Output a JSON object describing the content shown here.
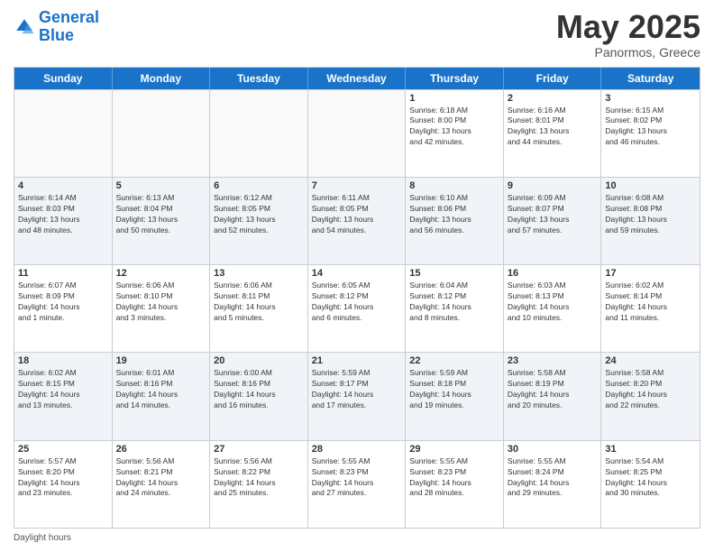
{
  "logo": {
    "line1": "General",
    "line2": "Blue"
  },
  "title": "May 2025",
  "subtitle": "Panormos, Greece",
  "days_of_week": [
    "Sunday",
    "Monday",
    "Tuesday",
    "Wednesday",
    "Thursday",
    "Friday",
    "Saturday"
  ],
  "footer": "Daylight hours",
  "weeks": [
    [
      {
        "day": "",
        "empty": true
      },
      {
        "day": "",
        "empty": true
      },
      {
        "day": "",
        "empty": true
      },
      {
        "day": "",
        "empty": true
      },
      {
        "day": "1",
        "info": "Sunrise: 6:18 AM\nSunset: 8:00 PM\nDaylight: 13 hours\nand 42 minutes."
      },
      {
        "day": "2",
        "info": "Sunrise: 6:16 AM\nSunset: 8:01 PM\nDaylight: 13 hours\nand 44 minutes."
      },
      {
        "day": "3",
        "info": "Sunrise: 6:15 AM\nSunset: 8:02 PM\nDaylight: 13 hours\nand 46 minutes."
      }
    ],
    [
      {
        "day": "4",
        "info": "Sunrise: 6:14 AM\nSunset: 8:03 PM\nDaylight: 13 hours\nand 48 minutes."
      },
      {
        "day": "5",
        "info": "Sunrise: 6:13 AM\nSunset: 8:04 PM\nDaylight: 13 hours\nand 50 minutes."
      },
      {
        "day": "6",
        "info": "Sunrise: 6:12 AM\nSunset: 8:05 PM\nDaylight: 13 hours\nand 52 minutes."
      },
      {
        "day": "7",
        "info": "Sunrise: 6:11 AM\nSunset: 8:05 PM\nDaylight: 13 hours\nand 54 minutes."
      },
      {
        "day": "8",
        "info": "Sunrise: 6:10 AM\nSunset: 8:06 PM\nDaylight: 13 hours\nand 56 minutes."
      },
      {
        "day": "9",
        "info": "Sunrise: 6:09 AM\nSunset: 8:07 PM\nDaylight: 13 hours\nand 57 minutes."
      },
      {
        "day": "10",
        "info": "Sunrise: 6:08 AM\nSunset: 8:08 PM\nDaylight: 13 hours\nand 59 minutes."
      }
    ],
    [
      {
        "day": "11",
        "info": "Sunrise: 6:07 AM\nSunset: 8:09 PM\nDaylight: 14 hours\nand 1 minute."
      },
      {
        "day": "12",
        "info": "Sunrise: 6:06 AM\nSunset: 8:10 PM\nDaylight: 14 hours\nand 3 minutes."
      },
      {
        "day": "13",
        "info": "Sunrise: 6:06 AM\nSunset: 8:11 PM\nDaylight: 14 hours\nand 5 minutes."
      },
      {
        "day": "14",
        "info": "Sunrise: 6:05 AM\nSunset: 8:12 PM\nDaylight: 14 hours\nand 6 minutes."
      },
      {
        "day": "15",
        "info": "Sunrise: 6:04 AM\nSunset: 8:12 PM\nDaylight: 14 hours\nand 8 minutes."
      },
      {
        "day": "16",
        "info": "Sunrise: 6:03 AM\nSunset: 8:13 PM\nDaylight: 14 hours\nand 10 minutes."
      },
      {
        "day": "17",
        "info": "Sunrise: 6:02 AM\nSunset: 8:14 PM\nDaylight: 14 hours\nand 11 minutes."
      }
    ],
    [
      {
        "day": "18",
        "info": "Sunrise: 6:02 AM\nSunset: 8:15 PM\nDaylight: 14 hours\nand 13 minutes."
      },
      {
        "day": "19",
        "info": "Sunrise: 6:01 AM\nSunset: 8:16 PM\nDaylight: 14 hours\nand 14 minutes."
      },
      {
        "day": "20",
        "info": "Sunrise: 6:00 AM\nSunset: 8:16 PM\nDaylight: 14 hours\nand 16 minutes."
      },
      {
        "day": "21",
        "info": "Sunrise: 5:59 AM\nSunset: 8:17 PM\nDaylight: 14 hours\nand 17 minutes."
      },
      {
        "day": "22",
        "info": "Sunrise: 5:59 AM\nSunset: 8:18 PM\nDaylight: 14 hours\nand 19 minutes."
      },
      {
        "day": "23",
        "info": "Sunrise: 5:58 AM\nSunset: 8:19 PM\nDaylight: 14 hours\nand 20 minutes."
      },
      {
        "day": "24",
        "info": "Sunrise: 5:58 AM\nSunset: 8:20 PM\nDaylight: 14 hours\nand 22 minutes."
      }
    ],
    [
      {
        "day": "25",
        "info": "Sunrise: 5:57 AM\nSunset: 8:20 PM\nDaylight: 14 hours\nand 23 minutes."
      },
      {
        "day": "26",
        "info": "Sunrise: 5:56 AM\nSunset: 8:21 PM\nDaylight: 14 hours\nand 24 minutes."
      },
      {
        "day": "27",
        "info": "Sunrise: 5:56 AM\nSunset: 8:22 PM\nDaylight: 14 hours\nand 25 minutes."
      },
      {
        "day": "28",
        "info": "Sunrise: 5:55 AM\nSunset: 8:23 PM\nDaylight: 14 hours\nand 27 minutes."
      },
      {
        "day": "29",
        "info": "Sunrise: 5:55 AM\nSunset: 8:23 PM\nDaylight: 14 hours\nand 28 minutes."
      },
      {
        "day": "30",
        "info": "Sunrise: 5:55 AM\nSunset: 8:24 PM\nDaylight: 14 hours\nand 29 minutes."
      },
      {
        "day": "31",
        "info": "Sunrise: 5:54 AM\nSunset: 8:25 PM\nDaylight: 14 hours\nand 30 minutes."
      }
    ]
  ]
}
